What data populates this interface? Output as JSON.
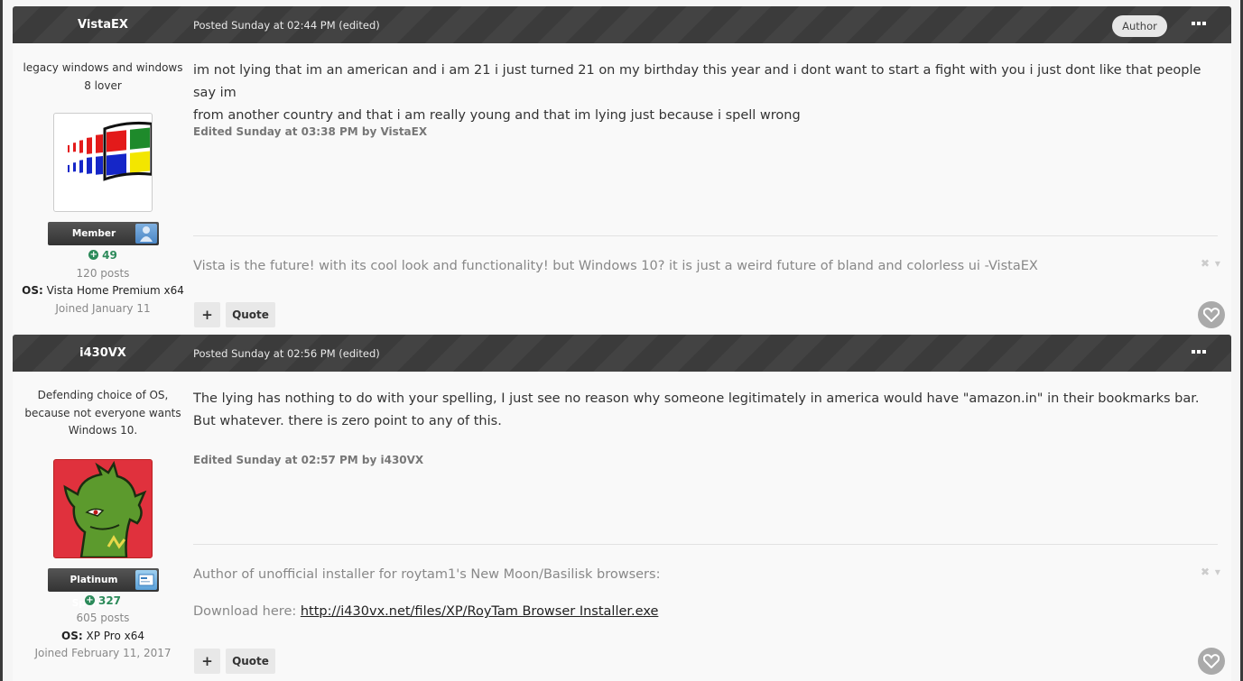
{
  "posts": [
    {
      "username": "VistaEX",
      "posted": "Posted Sunday at 02:44 PM (edited)",
      "author_badge": "Author",
      "user_title": "legacy windows and windows 8 lover",
      "avatar_icon": "windows-logo-icon",
      "group": "Member",
      "reputation": "49",
      "post_count": "120 posts",
      "os_label": "OS:",
      "os_value": "Vista Home Premium x64",
      "joined": "Joined January 11",
      "body_lines": [
        "im not lying that im an american and i am 21 i just turned 21 on my birthday this year  and i dont want to start a fight with you i just dont like that people say im",
        "from another country and that i  am really young and that im lying just because i spell wrong"
      ],
      "edited": "Edited Sunday at 03:38 PM by VistaEX",
      "signature": "Vista is the future! with its cool look and functionality! but Windows 10? it is just a weird future of bland and colorless ui -VistaEX"
    },
    {
      "username": "i430VX",
      "posted": "Posted Sunday at 02:56 PM (edited)",
      "user_title": "Defending choice of OS, because not everyone wants Windows 10.",
      "avatar_icon": "green-dragon-avatar-icon",
      "group": "Platinum Sponsor",
      "reputation": "327",
      "post_count": "605 posts",
      "os_label": "OS:",
      "os_value": "XP Pro x64",
      "joined": "Joined February 11, 2017",
      "body_lines": [
        "The lying has nothing to do with your spelling, I just see no reason why someone legitimately in america would have \"amazon.in\" in their bookmarks bar.",
        "But whatever. there is zero point to any of this."
      ],
      "edited": "Edited Sunday at 02:57 PM by i430VX",
      "signature_line1": "Author of unofficial installer for roytam1's New Moon/Basilisk browsers:",
      "signature_line2_prefix": "Download here: ",
      "signature_link": "http://i430vx.net/files/XP/RoyTam Browser Installer.exe"
    }
  ],
  "buttons": {
    "plus_label": "+",
    "quote_label": "Quote"
  },
  "sig_controls": "✖ ▾",
  "colors": {
    "header_bg": "#3d3d3d",
    "reputation_green": "#2c8a5a"
  }
}
